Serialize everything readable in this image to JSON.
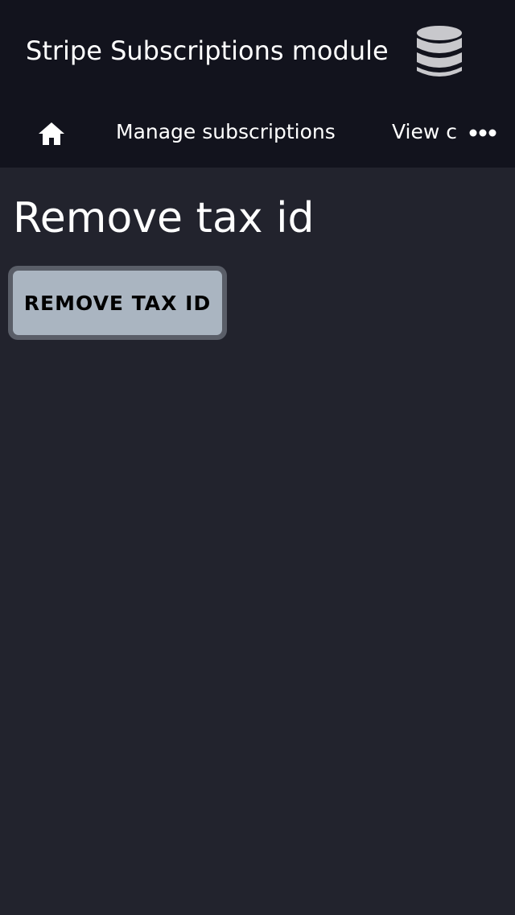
{
  "header": {
    "app_title": "Stripe Subscriptions module",
    "icon": "database-icon"
  },
  "nav": {
    "home_icon": "home-icon",
    "links": [
      {
        "label": "Manage subscriptions"
      },
      {
        "label": "View c"
      }
    ],
    "more_icon": "more-horizontal-icon"
  },
  "main": {
    "page_title": "Remove tax id",
    "remove_button_label": "REMOVE TAX ID"
  },
  "colors": {
    "header_bg": "#12131d",
    "page_bg": "#22232d",
    "button_bg": "#aab5c1",
    "button_border": "#5a5e68",
    "icon_gray": "#c8c8cc"
  }
}
